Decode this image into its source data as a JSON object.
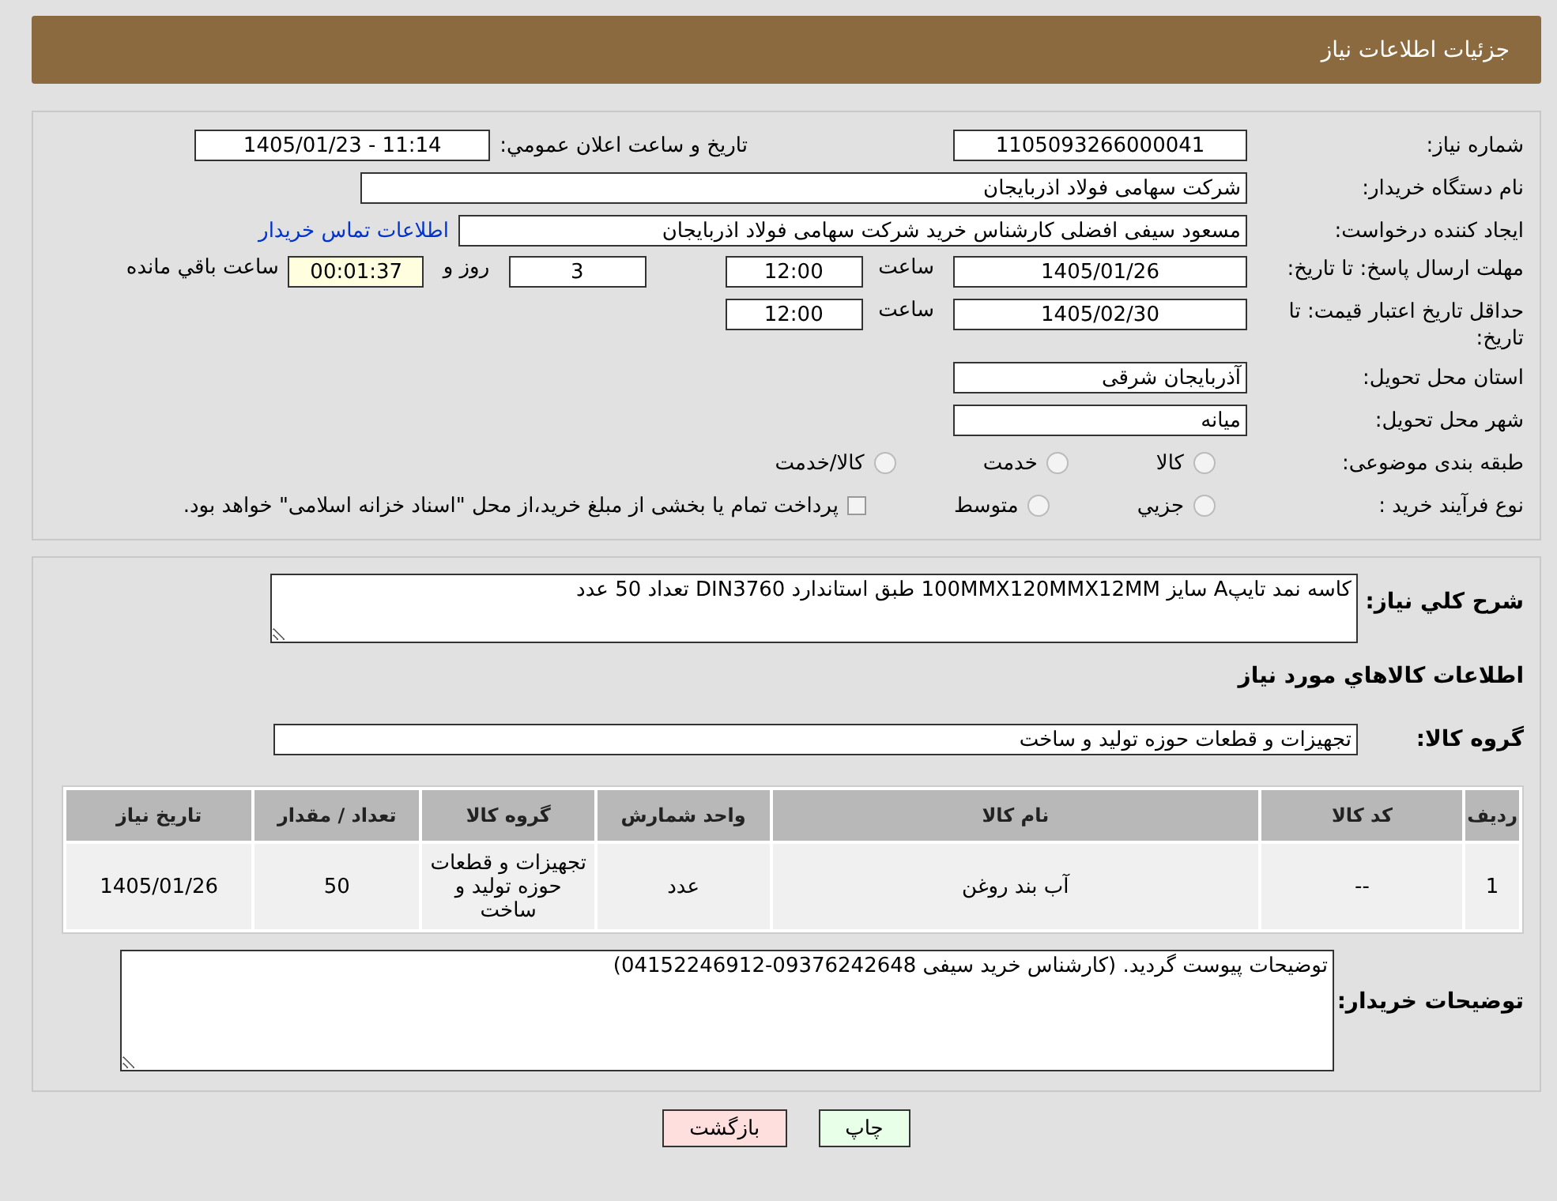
{
  "header": {
    "title": "جزئیات اطلاعات نیاز"
  },
  "details": {
    "need_number": {
      "label": "شماره نیاز:",
      "value": "1105093266000041"
    },
    "announce": {
      "label": "تاریخ و ساعت اعلان عمومي:",
      "value": "1405/01/23 - 11:14"
    },
    "buyer_org": {
      "label": "نام دستگاه خریدار:",
      "value": "شرکت سهامی فولاد اذربایجان"
    },
    "creator": {
      "label": "ایجاد کننده درخواست:",
      "value": "مسعود سیفی افضلی کارشناس خرید شرکت سهامی فولاد اذربایجان",
      "link": "اطلاعات تماس خریدار"
    },
    "reply_deadline": {
      "label": "مهلت ارسال پاسخ: تا تاریخ:",
      "date": "1405/01/26",
      "time_label": "ساعت",
      "time": "12:00",
      "days": "3",
      "days_label": "روز و",
      "remaining": "00:01:37",
      "remaining_label": "ساعت باقي مانده"
    },
    "price_validity": {
      "label": "حداقل تاریخ اعتبار قیمت: تا تاریخ:",
      "date": "1405/02/30",
      "time_label": "ساعت",
      "time": "12:00"
    },
    "province": {
      "label": "استان محل تحویل:",
      "value": "آذربایجان شرقی"
    },
    "city": {
      "label": "شهر محل تحویل:",
      "value": "میانه"
    },
    "category": {
      "label": "طبقه بندی موضوعی:",
      "options": [
        {
          "label": "کالا",
          "selected": false,
          "kind": "radio"
        },
        {
          "label": "خدمت",
          "selected": false,
          "kind": "radio"
        },
        {
          "label": "کالا/خدمت",
          "selected": false,
          "kind": "radio"
        }
      ]
    },
    "process": {
      "label": "نوع فرآیند خرید :",
      "options": [
        {
          "label": "جزيي",
          "selected": false,
          "kind": "radio"
        },
        {
          "label": "متوسط",
          "selected": false,
          "kind": "radio"
        },
        {
          "label": "پرداخت تمام یا بخشی از مبلغ خرید،از محل \"اسناد خزانه اسلامی\" خواهد بود.",
          "selected": false,
          "kind": "checkbox"
        }
      ]
    }
  },
  "summary": {
    "label": "شرح کلي نیاز:",
    "value": "کاسه نمد تایپA سایز 100MMX120MMX12MM طبق استاندارد DIN3760 تعداد 50 عدد"
  },
  "items_heading": "اطلاعات کالاهاي مورد نیاز",
  "goods_group": {
    "label": "گروه کالا:",
    "value": "تجهیزات و قطعات حوزه تولید و ساخت"
  },
  "table": {
    "columns": [
      "ردیف",
      "کد کالا",
      "نام کالا",
      "واحد شمارش",
      "گروه کالا",
      "تعداد / مقدار",
      "تاریخ نیاز"
    ],
    "rows": [
      [
        "1",
        "--",
        "آب بند روغن",
        "عدد",
        "تجهیزات و قطعات حوزه تولید و ساخت",
        "50",
        "1405/01/26"
      ]
    ]
  },
  "buyer_notes": {
    "label": "توضیحات خریدار:",
    "value": "توضیحات پیوست گردید. (کارشناس خرید سیفی 09376242648-04152246912)"
  },
  "buttons": [
    {
      "label": "چاپ",
      "kind": "print"
    },
    {
      "label": "بازگشت",
      "kind": "back"
    }
  ]
}
